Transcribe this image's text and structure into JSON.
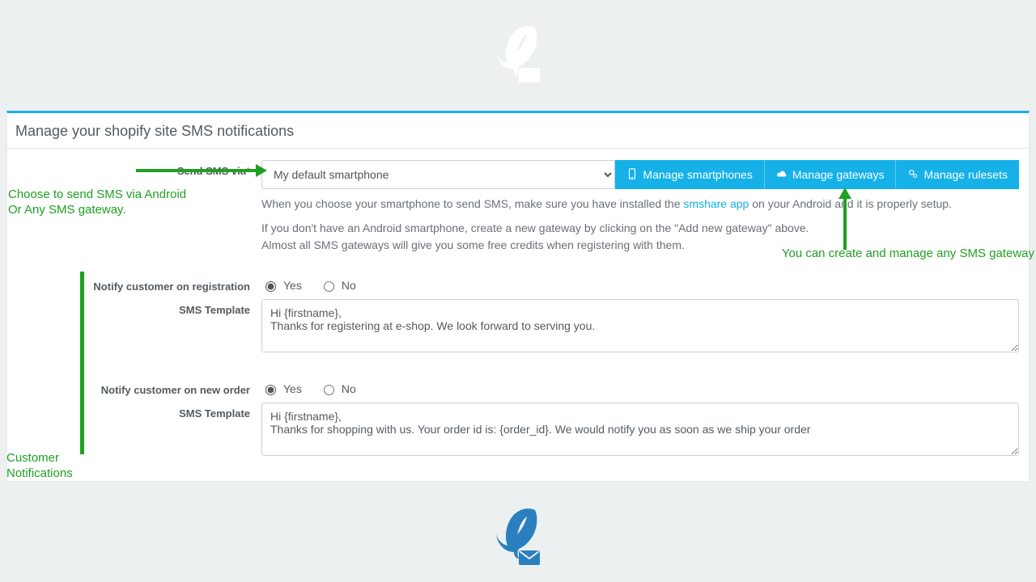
{
  "page": {
    "title": "Manage your shopify site SMS notifications"
  },
  "form": {
    "send_via": {
      "label": "Send SMS via",
      "required_mark": "*",
      "selected": "My default smartphone"
    },
    "buttons": {
      "manage_smartphones": "Manage smartphones",
      "manage_gateways": "Manage gateways",
      "manage_rulesets": "Manage rulesets"
    },
    "helper1_pre": "When you choose your smartphone to send SMS, make sure you have installed the ",
    "helper1_link": "smshare app",
    "helper1_post": " on your Android and it is properly setup.",
    "helper2_line1": "If you don't have an Android smartphone, create a new gateway by clicking on the \"Add new gateway\" above.",
    "helper2_line2": "Almost all SMS gateways will give you some free credits when registering with them.",
    "notify_registration": {
      "label": "Notify customer on registration",
      "yes": "Yes",
      "no": "No",
      "value": "yes",
      "template_label": "SMS Template",
      "template_value": "Hi {firstname},\nThanks for registering at e-shop. We look forward to serving you."
    },
    "notify_new_order": {
      "label": "Notify customer on new order",
      "yes": "Yes",
      "no": "No",
      "value": "yes",
      "template_label": "SMS Template",
      "template_value": "Hi {firstname},\nThanks for shopping with us. Your order id is: {order_id}. We would notify you as soon as we ship your order"
    }
  },
  "annotations": {
    "choose_gateway": "Choose to send SMS via Android\nOr Any SMS gateway.",
    "manage_gateway": "You can create and manage any SMS gateway",
    "customer_notifications": "Customer\nNotifications"
  }
}
